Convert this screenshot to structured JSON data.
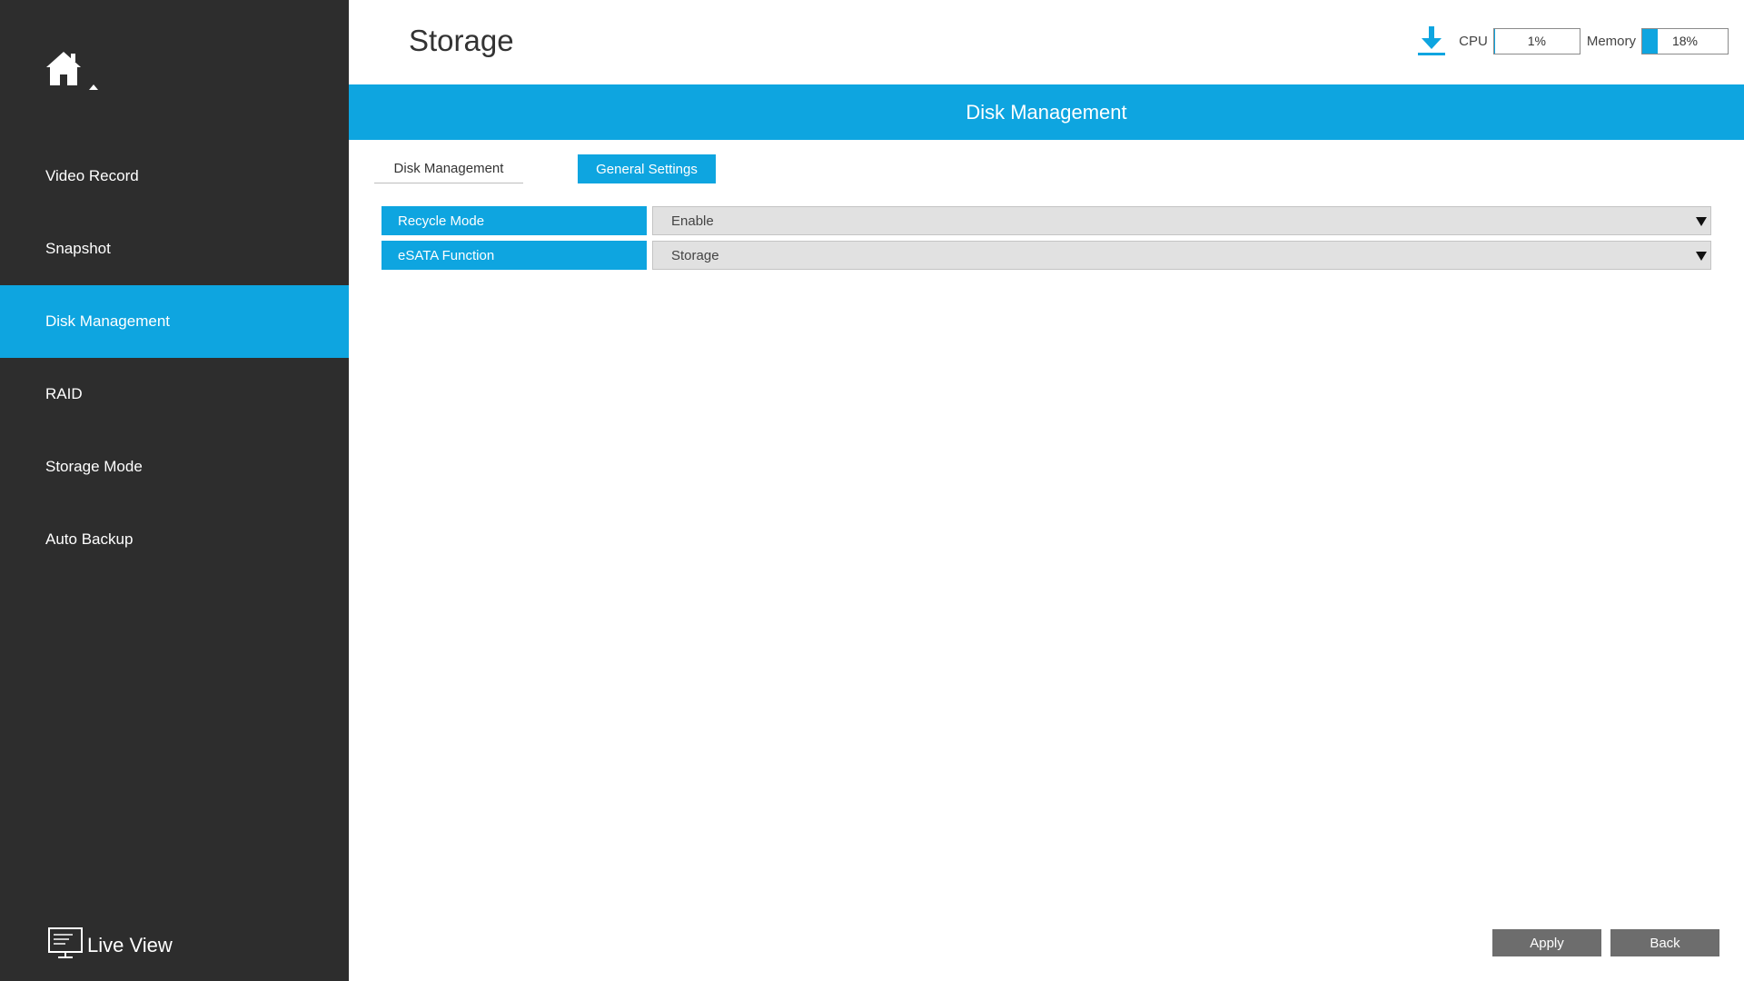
{
  "sidebar": {
    "items": [
      {
        "label": "Video Record",
        "active": false
      },
      {
        "label": "Snapshot",
        "active": false
      },
      {
        "label": "Disk Management",
        "active": true
      },
      {
        "label": "RAID",
        "active": false
      },
      {
        "label": "Storage Mode",
        "active": false
      },
      {
        "label": "Auto Backup",
        "active": false
      }
    ],
    "live_view_label": "Live View",
    "home_icon": "home-icon",
    "live_view_icon": "monitor-icon"
  },
  "header": {
    "title": "Storage",
    "download_icon": "download-icon",
    "cpu_label": "CPU",
    "cpu_value": "1%",
    "cpu_percent": 1,
    "memory_label": "Memory",
    "memory_value": "18%",
    "memory_percent": 18
  },
  "section": {
    "title": "Disk Management"
  },
  "tabs": [
    {
      "label": "Disk Management",
      "active": false
    },
    {
      "label": "General Settings",
      "active": true
    }
  ],
  "form": {
    "rows": [
      {
        "label": "Recycle Mode",
        "value": "Enable"
      },
      {
        "label": "eSATA Function",
        "value": "Storage"
      }
    ]
  },
  "buttons": {
    "apply": "Apply",
    "back": "Back"
  },
  "colors": {
    "accent": "#0ea5e0",
    "sidebar_bg": "#2d2d2d",
    "button_bg": "#6d6d6d"
  }
}
